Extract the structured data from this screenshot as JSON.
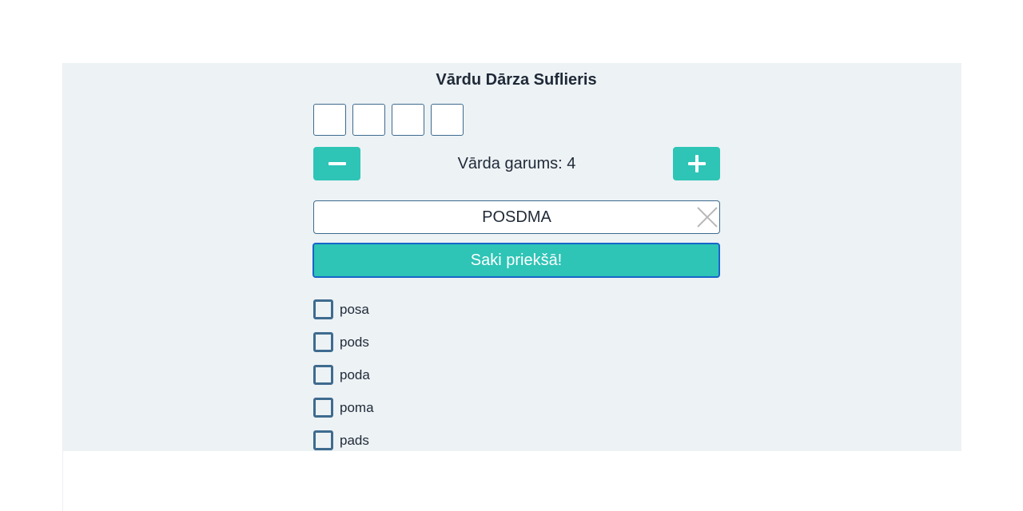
{
  "app": {
    "title": "Vārdu Dārza Suflieris"
  },
  "length_controls": {
    "label": "Vārda garums: 4",
    "decrease_icon": "minus-icon",
    "increase_icon": "plus-icon",
    "value": 4
  },
  "letter_slots": [
    "",
    "",
    "",
    ""
  ],
  "letters_input": {
    "value": "POSDMA",
    "clear_icon": "close-icon"
  },
  "submit": {
    "label": "Saki priekšā!"
  },
  "results": [
    {
      "word": "posa",
      "checked": false
    },
    {
      "word": "pods",
      "checked": false
    },
    {
      "word": "poda",
      "checked": false
    },
    {
      "word": "poma",
      "checked": false
    },
    {
      "word": "pads",
      "checked": false
    }
  ],
  "colors": {
    "accent": "#2ec4b6",
    "border": "#3e6b8f",
    "focus_border": "#1766c9",
    "panel_bg": "#edf2f5"
  }
}
